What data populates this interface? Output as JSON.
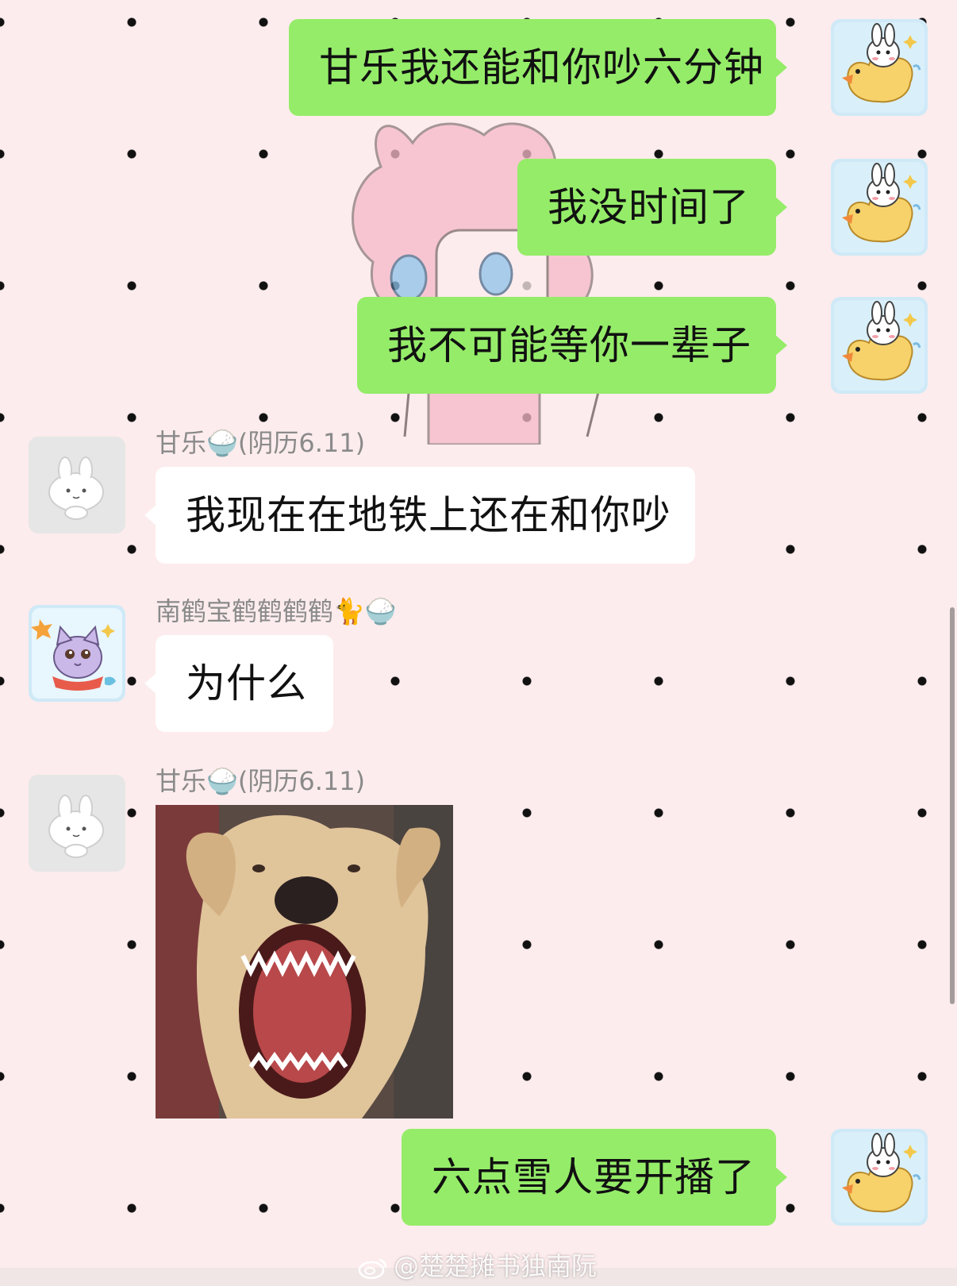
{
  "colors": {
    "background": "#fdeced",
    "my_bubble": "#95ec69",
    "their_bubble": "#ffffff",
    "sender_name": "#8a8a8a"
  },
  "messages": [
    {
      "side": "right",
      "text": "甘乐我还能和你吵六分钟",
      "avatar": "rabbit-duck-avatar"
    },
    {
      "side": "right",
      "text": "我没时间了",
      "avatar": "rabbit-duck-avatar"
    },
    {
      "side": "right",
      "text": "我不可能等你一辈子",
      "avatar": "rabbit-duck-avatar"
    },
    {
      "side": "left",
      "sender": "甘乐🍚(阴历6.11)",
      "text": "我现在在地铁上还在和你吵",
      "avatar": "white-rabbit-avatar"
    },
    {
      "side": "left",
      "sender": "南鹤宝鹤鹤鹤鹤🐈🍚",
      "text": "为什么",
      "avatar": "purple-cat-avatar"
    },
    {
      "side": "left",
      "sender": "甘乐🍚(阴历6.11)",
      "image": "snarling-dog-photo",
      "avatar": "white-rabbit-avatar"
    },
    {
      "side": "right",
      "text": "六点雪人要开播了",
      "avatar": "rabbit-duck-avatar"
    }
  ],
  "watermark": "@楚楚摊书独南阮"
}
